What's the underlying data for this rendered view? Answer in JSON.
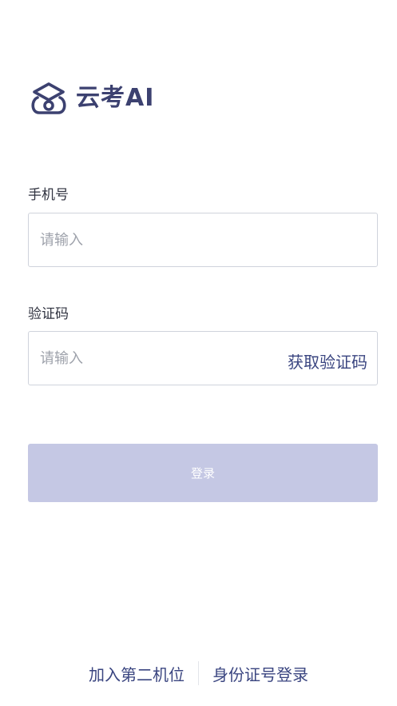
{
  "logo": {
    "text": "云考AI",
    "icon": "graduation-cap-icon",
    "color": "#3c4170"
  },
  "phone": {
    "label": "手机号",
    "placeholder": "请输入",
    "value": ""
  },
  "code": {
    "label": "验证码",
    "placeholder": "请输入",
    "value": "",
    "get_code_label": "获取验证码"
  },
  "login": {
    "label": "登录",
    "color": "#c5c8e4"
  },
  "footer": {
    "join_second_camera": "加入第二机位",
    "id_card_login": "身份证号登录"
  },
  "colors": {
    "accent": "#3a4580",
    "border": "#cfd3dc"
  }
}
